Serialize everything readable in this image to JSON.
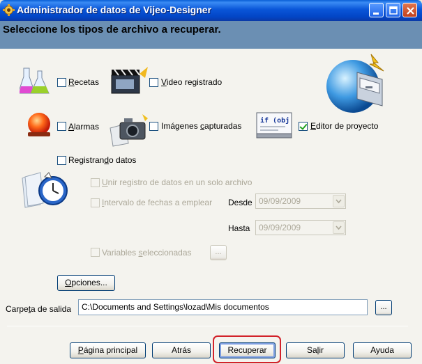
{
  "window": {
    "title": "Administrador de datos de Vijeo-Designer"
  },
  "header": {
    "text": "Seleccione los tipos de archivo a recuperar."
  },
  "options": {
    "recetas": {
      "label_u": "R",
      "label_rest": "ecetas",
      "checked": false
    },
    "video": {
      "label_u": "V",
      "label_rest": "ideo registrado",
      "checked": false
    },
    "alarmas": {
      "label_u": "A",
      "label_rest": "larmas",
      "checked": false
    },
    "imagenes": {
      "label_pre": "Imágenes ",
      "label_u": "c",
      "label_rest": "apturadas",
      "checked": false
    },
    "editor": {
      "label_u": "E",
      "label_rest": "ditor de proyecto",
      "checked": true
    },
    "registrando": {
      "label_pre": "Registran",
      "label_u": "d",
      "label_rest": "o datos",
      "checked": false
    }
  },
  "logging": {
    "unir": {
      "label_u": "U",
      "label_rest": "nir registro de datos en un solo archivo"
    },
    "intervalo": {
      "label_u": "I",
      "label_rest": "ntervalo de fechas a emplear"
    },
    "desde_label": "Desde",
    "desde_value": "09/09/2009",
    "hasta_label": "Hasta",
    "hasta_value": "09/09/2009",
    "variables": {
      "label_pre": "Variables ",
      "label_u": "s",
      "label_rest": "eleccionadas"
    },
    "browse_label": "..."
  },
  "opciones_button": {
    "label_u": "O",
    "label_rest": "pciones..."
  },
  "output": {
    "label_pre": "Carpe",
    "label_u": "t",
    "label_rest": "a de salida",
    "value": "C:\\Documents and Settings\\lozad\\Mis documentos",
    "browse_label": "..."
  },
  "footer": {
    "home": {
      "label_u": "P",
      "label_rest": "ágina principal"
    },
    "back": "Atrás",
    "retrieve": "Recuperar",
    "exit": {
      "label_pre": "Sa",
      "label_u": "l",
      "label_rest": "ir"
    },
    "help": "Ayuda"
  },
  "colors": {
    "titlebar": "#0a56d8",
    "header": "#6b8fb3",
    "highlight": "#d2222a"
  }
}
